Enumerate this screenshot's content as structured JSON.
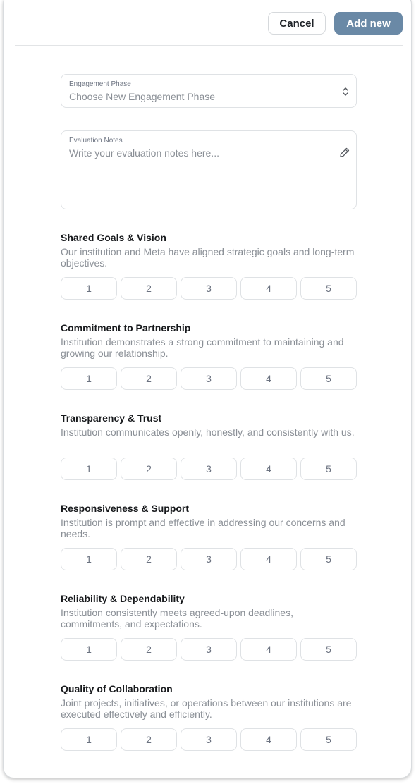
{
  "header": {
    "cancel_label": "Cancel",
    "add_label": "Add new",
    "accent_color": "#6a89a6"
  },
  "phase_field": {
    "label": "Engagement Phase",
    "placeholder": "Choose New Engagement Phase",
    "icon": "chevron-up-down-icon"
  },
  "notes_field": {
    "label": "Evaluation Notes",
    "placeholder": "Write your evaluation notes here...",
    "icon": "pencil-icon"
  },
  "rating_options": [
    "1",
    "2",
    "3",
    "4",
    "5"
  ],
  "sections": [
    {
      "title": "Shared Goals & Vision",
      "description": "Our institution and Meta have aligned strategic goals and long-term objectives."
    },
    {
      "title": "Commitment to Partnership",
      "description": "Institution demonstrates a strong commitment to maintaining and growing our relationship."
    },
    {
      "title": "Transparency & Trust",
      "description": "Institution communicates openly, honestly, and consistently with us."
    },
    {
      "title": "Responsiveness & Support",
      "description": "Institution is prompt and effective in addressing our concerns and needs."
    },
    {
      "title": "Reliability & Dependability",
      "description": "Institution consistently meets agreed-upon deadlines, commitments, and expectations."
    },
    {
      "title": "Quality of Collaboration",
      "description": "Joint projects, initiatives, or operations between our institutions are executed effectively and efficiently."
    }
  ]
}
